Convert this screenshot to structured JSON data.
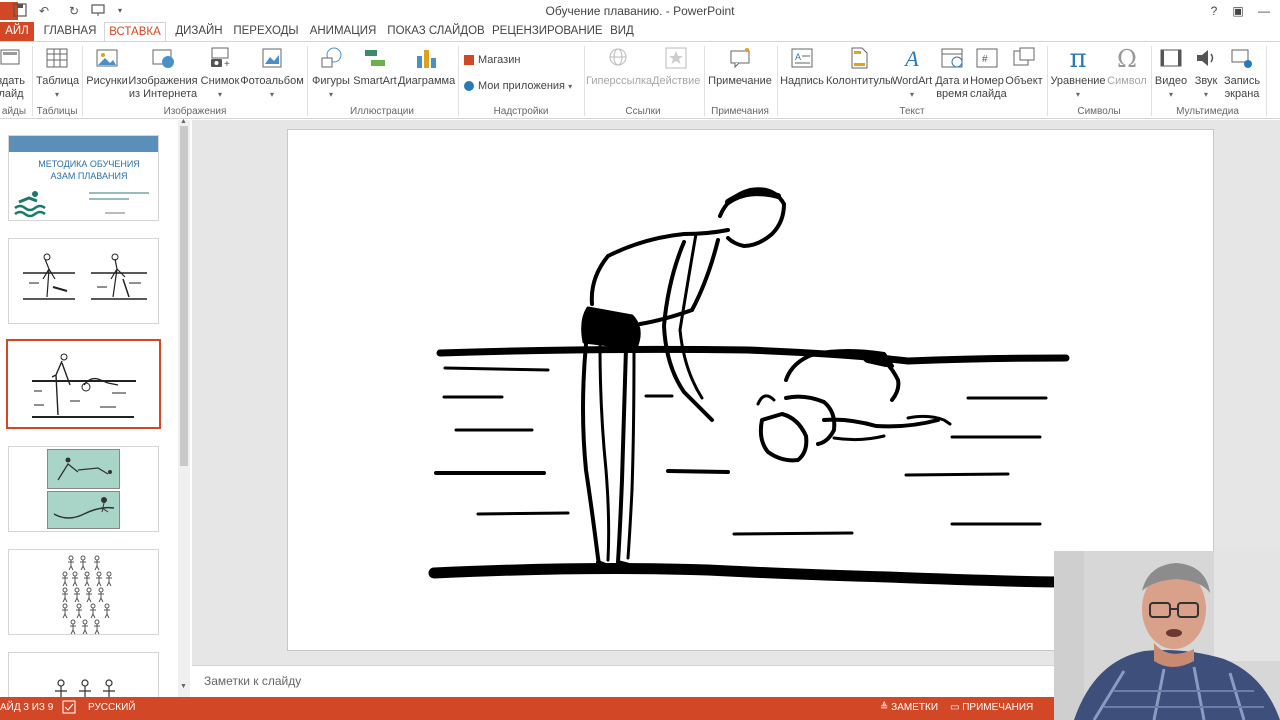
{
  "titlebar": {
    "title": "Обучение плаванию. - PowerPoint",
    "help": "?",
    "restore": "▣",
    "minimize": "—",
    "maximize": "□",
    "close": "✕"
  },
  "tabs": [
    {
      "label": "АЙЛ"
    },
    {
      "label": "ГЛАВНАЯ"
    },
    {
      "label": "ВСТАВКА"
    },
    {
      "label": "ДИЗАЙН"
    },
    {
      "label": "ПЕРЕХОДЫ"
    },
    {
      "label": "АНИМАЦИЯ"
    },
    {
      "label": "ПОКАЗ СЛАЙДОВ"
    },
    {
      "label": "РЕЦЕНЗИРОВАНИЕ"
    },
    {
      "label": "ВИД"
    }
  ],
  "ribbon": {
    "new_slide": "здать\nлайд",
    "table": "Таблица",
    "pictures": "Рисунки",
    "online_pictures": "Изображения\nиз Интернета",
    "screenshot": "Снимок",
    "photo_album": "Фотоальбом",
    "shapes": "Фигуры",
    "smartart": "SmartArt",
    "chart": "Диаграмма",
    "store": "Магазин",
    "my_apps": "Мои приложения",
    "hyperlink": "Гиперссылка",
    "action": "Действие",
    "comment": "Примечание",
    "textbox": "Надпись",
    "header_footer": "Колонтитулы",
    "wordart": "WordArt",
    "date_time": "Дата и\nвремя",
    "slide_number": "Номер\nслайда",
    "object": "Объект",
    "equation": "Уравнение",
    "symbol": "Символ",
    "video": "Видео",
    "audio": "Звук",
    "screen_recording": "Запись\nэкрана",
    "groups": {
      "slides": "айды",
      "tables": "Таблицы",
      "images": "Изображения",
      "illustrations": "Иллюстрации",
      "addins": "Надстройки",
      "links": "Ссылки",
      "comments": "Примечания",
      "text": "Текст",
      "symbols": "Символы",
      "media": "Мультимедиа"
    }
  },
  "thumbnails": {
    "slide1_title": "МЕТОДИКА ОБУЧЕНИЯ АЗАМ ПЛАВАНИЯ"
  },
  "notes": {
    "placeholder": "Заметки к слайду"
  },
  "statusbar": {
    "slide_info": "АЙД 3 ИЗ 9",
    "language": "РУССКИЙ",
    "notes": "ЗАМЕТКИ",
    "comments": "ПРИМЕЧАНИЯ"
  },
  "colors": {
    "accent": "#d24726"
  }
}
